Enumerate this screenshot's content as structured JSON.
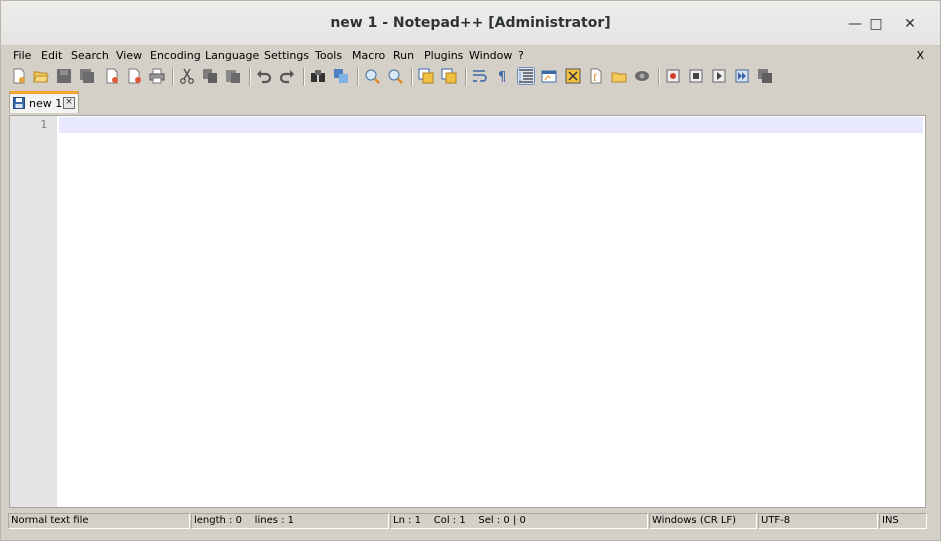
{
  "window": {
    "title": "new 1 - Notepad++ [Administrator]",
    "minimize": "—",
    "maximize": "□",
    "close": "✕"
  },
  "menubar": {
    "items": [
      "File",
      "Edit",
      "Search",
      "View",
      "Encoding",
      "Language",
      "Settings",
      "Tools",
      "Macro",
      "Run",
      "Plugins",
      "Window",
      "?"
    ],
    "close": "X"
  },
  "toolbar": {
    "icons": [
      "new-file-icon",
      "open-file-icon",
      "save-icon",
      "save-all-icon",
      "close-icon",
      "close-all-icon",
      "print-icon",
      "cut-icon",
      "copy-icon",
      "paste-icon",
      "undo-icon",
      "redo-icon",
      "find-icon",
      "replace-icon",
      "zoom-in-icon",
      "zoom-out-icon",
      "sync-vertical-icon",
      "sync-horizontal-icon",
      "word-wrap-icon",
      "show-all-chars-icon",
      "indent-guide-icon",
      "user-defined-language-icon",
      "document-map-icon",
      "function-list-icon",
      "folder-as-workspace-icon",
      "monitoring-icon",
      "record-macro-icon",
      "stop-record-icon",
      "play-macro-icon",
      "run-macro-multiple-icon",
      "save-macro-icon"
    ]
  },
  "tabs": [
    {
      "label": "new 1",
      "close": "×"
    }
  ],
  "editor": {
    "line_numbers": [
      "1"
    ],
    "content": ""
  },
  "statusbar": {
    "file_type": "Normal text file",
    "length_lines": "length : 0    lines : 1",
    "position": "Ln : 1    Col : 1    Sel : 0 | 0",
    "eol": "Windows (CR LF)",
    "encoding": "UTF-8",
    "mode": "INS"
  }
}
